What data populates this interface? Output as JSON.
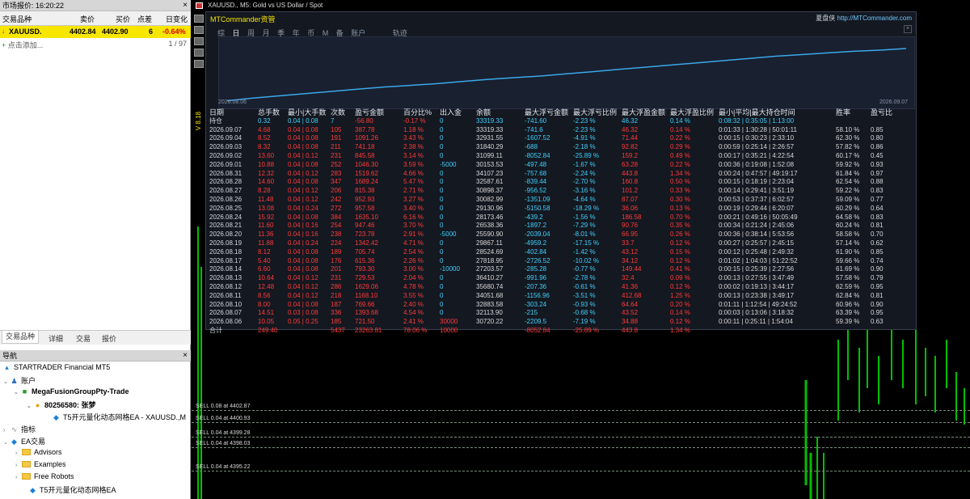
{
  "market_watch": {
    "title": "市场报价: 16:20:22",
    "columns": [
      "交易品种",
      "卖价",
      "买价",
      "点差",
      "日变化"
    ],
    "row": {
      "symbol": "XAUUSD.",
      "bid": "4402.84",
      "ask": "4402.90",
      "spread": "6",
      "change": "-0.64%"
    },
    "add_label": "点击添加...",
    "count": "1 / 97",
    "tabs": [
      "交易品种",
      "详细",
      "交易",
      "报价"
    ]
  },
  "navigator": {
    "title": "导航",
    "items": [
      "STARTRADER Financial MT5",
      "账户",
      "MegaFusionGroupPty-Trade",
      "80256580: 张梦",
      "T5开元量化动态网格EA - XAUUSD.,M",
      "指标",
      "EA交易",
      "Advisors",
      "Examples",
      "Free Robots",
      "T5开元量化动态网格EA"
    ]
  },
  "chart": {
    "title": "XAUUSD., M5: Gold vs US Dollar / Spot",
    "sell_lines": [
      "SELL 0.08 at 4402.87",
      "SELL 0.04 at 4400.93",
      "SELL 0.04 at 4399.28",
      "SELL 0.04 at 4398.03",
      "SELL 0.04 at 4395.22"
    ]
  },
  "panel": {
    "brand": "MTCommander资管",
    "right_name": "夏盘侠",
    "right_url": "http://MTCommander.com",
    "tabs": [
      "综",
      "日",
      "周",
      "月",
      "季",
      "年",
      "币",
      "M",
      "备",
      "账户",
      "轨迹"
    ],
    "date_start": "2026.08.06",
    "date_end": "2026.09.07",
    "headers": [
      "日期",
      "总手数",
      "最小|大手数",
      "次数",
      "盈亏金额",
      "百分比%",
      "出入金",
      "余额",
      "最大浮亏金额",
      "最大浮亏比例",
      "最大浮盈金额",
      "最大浮盈比例",
      "最小|平均|最大持仓时间",
      "胜率",
      "盈亏比"
    ],
    "holding": [
      "持仓",
      "0.32",
      "0.04 | 0.08",
      "7",
      "-56.80",
      "-0.17 %",
      "0",
      "33319.33",
      "-741.60",
      "-2.23 %",
      "46.32",
      "0.14 %",
      "0:08:32 | 0:35:05 | 1:13:00",
      "",
      ""
    ],
    "rows": [
      [
        "2026.09.07",
        "4.68",
        "0.04 | 0.08",
        "105",
        "387.78",
        "1.18 %",
        "0",
        "33319.33",
        "-741.6",
        "-2.23 %",
        "46.32",
        "0.14 %",
        "0:01:33 | 1:30:28 | 50:01:11",
        "58.10 %",
        "0.85"
      ],
      [
        "2026.09.04",
        "8.52",
        "0.04 | 0.08",
        "191",
        "1091.26",
        "3.43 %",
        "0",
        "32931.55",
        "-1607.52",
        "-4.91 %",
        "71.44",
        "0.22 %",
        "0:00:15 | 0:30:23 | 2:33:10",
        "62.30 %",
        "0.80"
      ],
      [
        "2026.09.03",
        "8.32",
        "0.04 | 0.08",
        "211",
        "741.18",
        "2.38 %",
        "0",
        "31840.29",
        "-688",
        "-2.18 %",
        "92.82",
        "0.29 %",
        "0:00:59 | 0:25:14 | 2:26:57",
        "57.82 %",
        "0.86"
      ],
      [
        "2026.09.02",
        "13.60",
        "0.04 | 0.12",
        "231",
        "845.58",
        "3.14 %",
        "0",
        "31099.11",
        "-8052.84",
        "-25.89 %",
        "159.2",
        "0.49 %",
        "0:00:17 | 0:35:21 | 4:22:54",
        "60.17 %",
        "0.45"
      ],
      [
        "2026.09.01",
        "10.88",
        "0.04 | 0.08",
        "252",
        "1046.30",
        "3.59 %",
        "-5000",
        "30153.53",
        "-497.48",
        "-1.67 %",
        "63.28",
        "0.22 %",
        "0:00:36 | 0:19:08 | 1:52:08",
        "59.92 %",
        "0.93"
      ],
      [
        "2026.08.31",
        "12.32",
        "0.04 | 0.12",
        "283",
        "1519.62",
        "4.66 %",
        "0",
        "34107.23",
        "-757.68",
        "-2.24 %",
        "443.8",
        "1.34 %",
        "0:00:24 | 0:47:57 | 49:19:17",
        "61.84 %",
        "0.97"
      ],
      [
        "2026.08.28",
        "14.60",
        "0.04 | 0.08",
        "347",
        "1689.24",
        "5.47 %",
        "0",
        "32587.61",
        "-839.44",
        "-2.70 %",
        "160.8",
        "0.50 %",
        "0:00:15 | 0:18:19 | 2:23:04",
        "62.54 %",
        "0.88"
      ],
      [
        "2026.08.27",
        "8.28",
        "0.04 | 0.12",
        "206",
        "815.38",
        "2.71 %",
        "0",
        "30898.37",
        "-956.52",
        "-3.16 %",
        "101.2",
        "0.33 %",
        "0:00:14 | 0:29:41 | 3:51:19",
        "59.22 %",
        "0.83"
      ],
      [
        "2026.08.26",
        "11.48",
        "0.04 | 0.12",
        "242",
        "952.93",
        "3.27 %",
        "0",
        "30082.99",
        "-1351.09",
        "-4.64 %",
        "87.07",
        "0.30 %",
        "0:00:53 | 0:37:37 | 6:02:57",
        "59.09 %",
        "0.77"
      ],
      [
        "2026.08.25",
        "13.08",
        "0.04 | 0.24",
        "272",
        "957.58",
        "3.40 %",
        "0",
        "29130.96",
        "-5150.58",
        "-18.29 %",
        "36.06",
        "0.13 %",
        "0:00:19 | 0:29:44 | 6:20:07",
        "60.29 %",
        "0.64"
      ],
      [
        "2026.08.24",
        "15.92",
        "0.04 | 0.08",
        "384",
        "1635.10",
        "6.16 %",
        "0",
        "28173.46",
        "-439.2",
        "-1.56 %",
        "186.58",
        "0.70 %",
        "0:00:21 | 0:49:16 | 50:05:49",
        "64.58 %",
        "0.83"
      ],
      [
        "2026.08.21",
        "11.60",
        "0.04 | 0.16",
        "254",
        "947.46",
        "3.70 %",
        "0",
        "26538.36",
        "-1897.2",
        "-7.29 %",
        "90.76",
        "0.35 %",
        "0:00:34 | 0:21:24 | 2:45:06",
        "60.24 %",
        "0.81"
      ],
      [
        "2026.08.20",
        "11.36",
        "0.04 | 0.16",
        "238",
        "723.78",
        "2.91 %",
        "-5000",
        "25590.90",
        "-2039.04",
        "-8.01 %",
        "66.95",
        "0.26 %",
        "0:00:36 | 0:38:14 | 5:53:56",
        "58.58 %",
        "0.70"
      ],
      [
        "2026.08.19",
        "11.88",
        "0.04 | 0.24",
        "224",
        "1342.42",
        "4.71 %",
        "0",
        "29867.11",
        "-4959.2",
        "-17.15 %",
        "33.7",
        "0.12 %",
        "0:00:27 | 0:25:57 | 2:45:15",
        "57.14 %",
        "0.62"
      ],
      [
        "2026.08.18",
        "8.12",
        "0.04 | 0.08",
        "189",
        "705.74",
        "2.54 %",
        "0",
        "28524.69",
        "-402.84",
        "-1.42 %",
        "43.12",
        "0.15 %",
        "0:00:12 | 0:25:48 | 2:49:32",
        "61.90 %",
        "0.85"
      ],
      [
        "2026.08.17",
        "5.40",
        "0.04 | 0.08",
        "176",
        "615.36",
        "2.26 %",
        "0",
        "27818.95",
        "-2726.52",
        "-10.02 %",
        "34.12",
        "0.12 %",
        "0:01:02 | 1:04:03 | 51:22:52",
        "59.66 %",
        "0.74"
      ],
      [
        "2026.08.14",
        "6.60",
        "0.04 | 0.08",
        "201",
        "793.30",
        "3.00 %",
        "-10000",
        "27203.57",
        "-285.28",
        "-0.77 %",
        "149.44",
        "0.41 %",
        "0:00:15 | 0:25:39 | 2:27:56",
        "61.69 %",
        "0.90"
      ],
      [
        "2026.08.13",
        "10.64",
        "0.04 | 0.12",
        "231",
        "729.53",
        "2.04 %",
        "0",
        "36410.27",
        "-991.96",
        "-2.78 %",
        "32.4",
        "0.09 %",
        "0:00:13 | 0:27:55 | 3:47:49",
        "57.58 %",
        "0.79"
      ],
      [
        "2026.08.12",
        "12.48",
        "0.04 | 0.12",
        "286",
        "1629.06",
        "4.78 %",
        "0",
        "35680.74",
        "-207.36",
        "-0.61 %",
        "41.36",
        "0.12 %",
        "0:00:02 | 0:19:13 | 3:44:17",
        "62.59 %",
        "0.95"
      ],
      [
        "2026.08.11",
        "8.56",
        "0.04 | 0.12",
        "218",
        "1168.10",
        "3.55 %",
        "0",
        "34051.68",
        "-1156.96",
        "-3.51 %",
        "412.68",
        "1.25 %",
        "0:00:13 | 0:23:38 | 3:49:17",
        "62.84 %",
        "0.81"
      ],
      [
        "2026.08.10",
        "8.00",
        "0.04 | 0.08",
        "187",
        "769.66",
        "2.40 %",
        "0",
        "32883.58",
        "-303.24",
        "-0.93 %",
        "64.64",
        "0.20 %",
        "0:01:11 | 1:12:54 | 49:24:52",
        "60.96 %",
        "0.90"
      ],
      [
        "2026.08.07",
        "14.51",
        "0.03 | 0.08",
        "336",
        "1393.68",
        "4.54 %",
        "0",
        "32113.90",
        "-215",
        "-0.68 %",
        "43.52",
        "0.14 %",
        "0:00:03 | 0:13:06 | 3:18:32",
        "63.39 %",
        "0.95"
      ],
      [
        "2026.08.06",
        "10.05",
        "0.05 | 0.25",
        "185",
        "721.50",
        "2.41 %",
        "30000",
        "30720.22",
        "-2209.5",
        "-7.19 %",
        "34.88",
        "0.12 %",
        "0:00:11 | 0:25:11 | 1:54:04",
        "59.39 %",
        "0.63"
      ]
    ],
    "total": [
      "合计",
      "249.40",
      "",
      "5437",
      "23263.81",
      "78.06 %",
      "10000",
      "",
      "-8052.84",
      "-25.89 %",
      "443.8",
      "1.34 %",
      "",
      "",
      ""
    ],
    "curve_points": [
      0.05,
      0.1,
      0.14,
      0.18,
      0.22,
      0.26,
      0.3,
      0.33,
      0.36,
      0.4,
      0.44,
      0.47,
      0.5,
      0.54,
      0.58,
      0.62,
      0.66,
      0.7,
      0.74,
      0.78,
      0.82,
      0.86,
      0.89,
      0.92,
      0.95,
      0.97,
      1.0
    ]
  },
  "colors": {
    "accent_yellow": "#f7e600",
    "red": "#ff3a3a",
    "cyan": "#40d0ff",
    "line_blue": "#3aa8e8",
    "change_red": "#d80000"
  }
}
